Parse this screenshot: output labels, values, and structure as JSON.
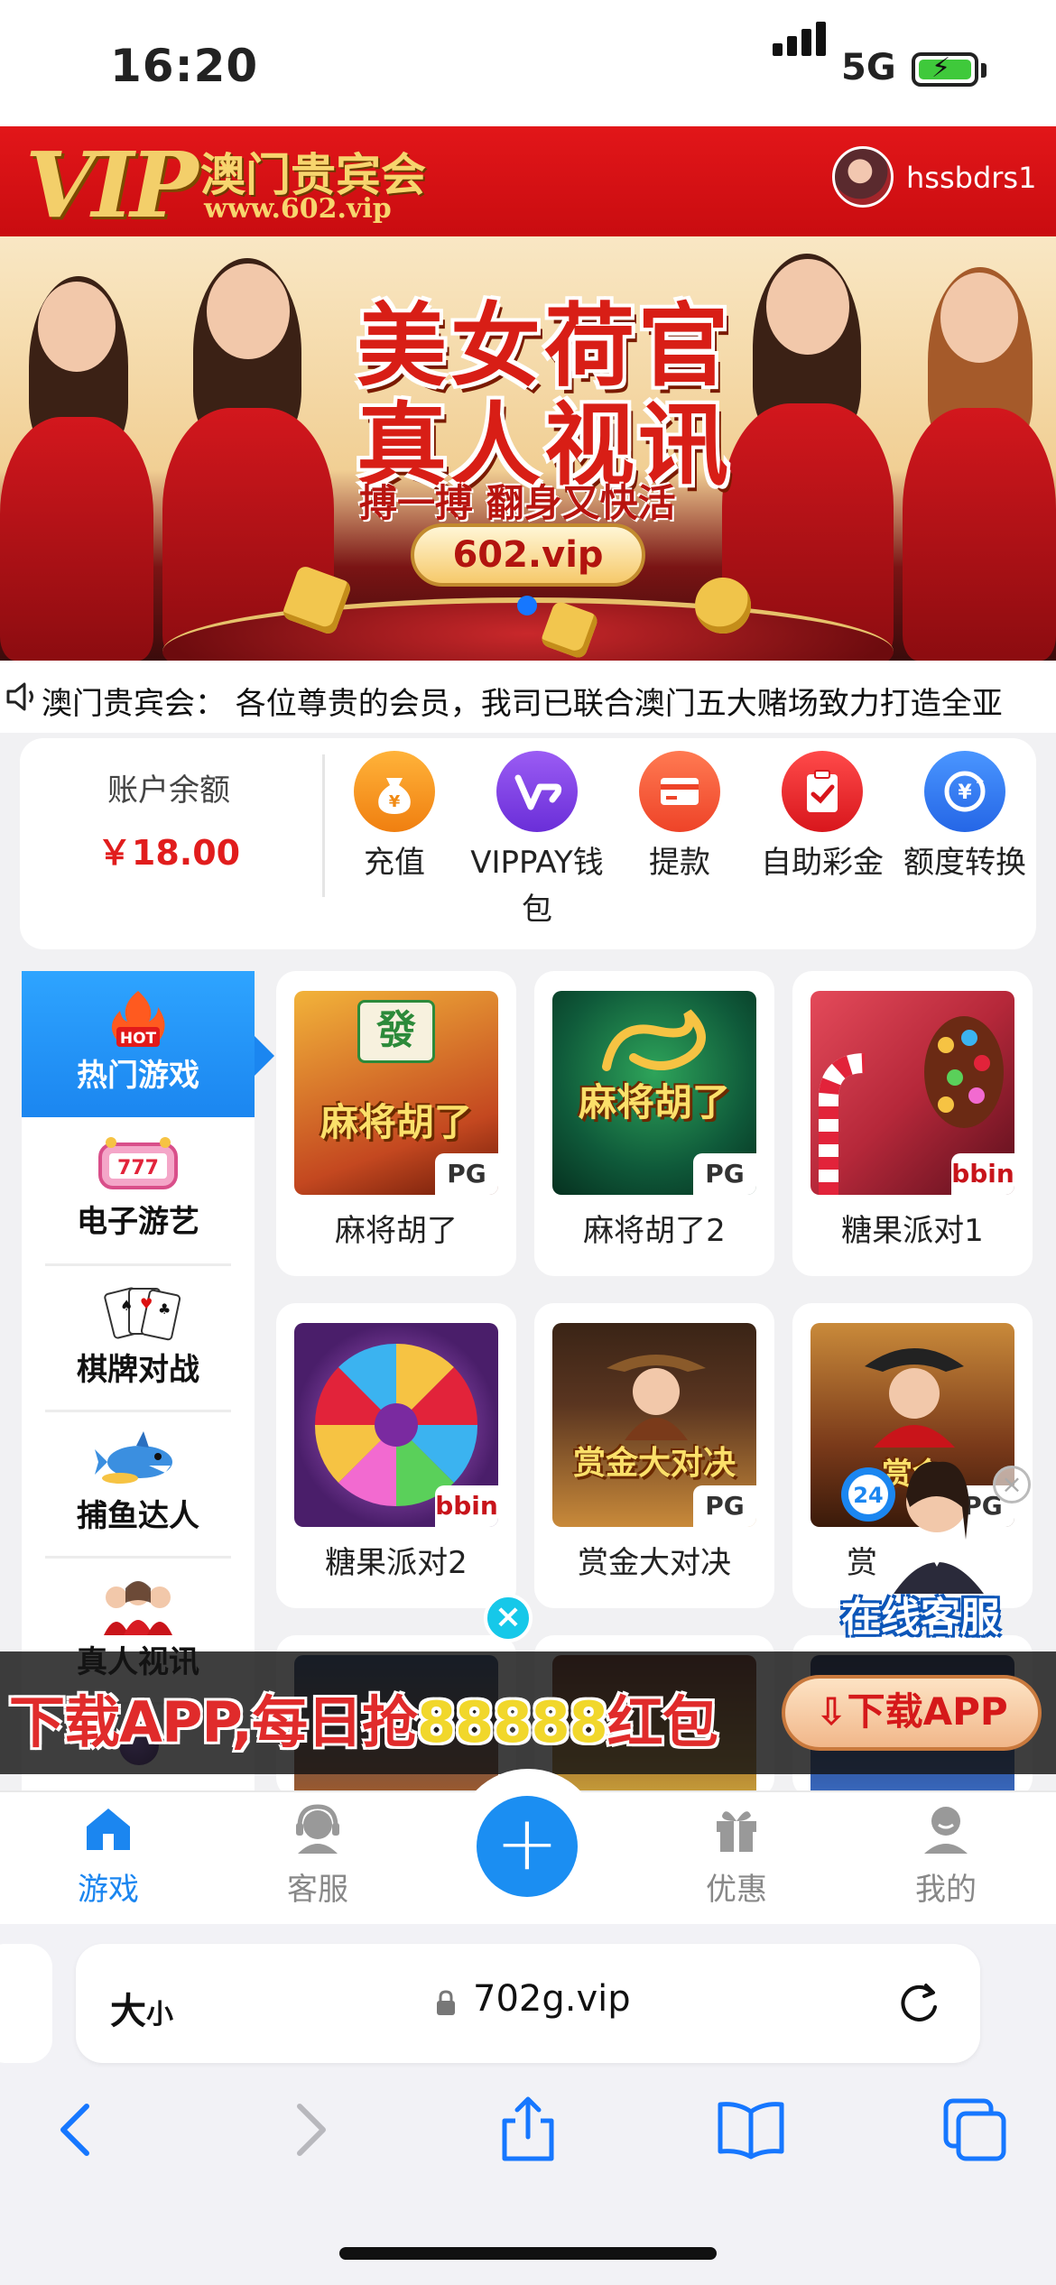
{
  "status": {
    "time": "16:20",
    "network": "5G"
  },
  "header": {
    "logo_vip": "VIP",
    "logo_name": "澳门贵宾会",
    "logo_url": "www.602.vip",
    "username": "hssbdrs1"
  },
  "banner": {
    "title_line1": "美女荷官",
    "title_line2": "真人视讯",
    "slogan": "搏一搏 翻身又快活",
    "site": "602.vip"
  },
  "notice": {
    "text": "澳门贵宾会： 各位尊贵的会员，我司已联合澳门五大赌场致力打造全亚"
  },
  "account": {
    "balance_label": "账户余额",
    "balance_value": "￥18.00",
    "actions": [
      {
        "label": "充值",
        "icon": "money-bag-icon",
        "color": "#f79a1e"
      },
      {
        "label": "VIPPAY钱包",
        "icon": "vippay-icon",
        "color": "#7b3fe0"
      },
      {
        "label": "提款",
        "icon": "card-icon",
        "color": "#f0563a"
      },
      {
        "label": "自助彩金",
        "icon": "clipboard-check-icon",
        "color": "#e6262c"
      },
      {
        "label": "额度转换",
        "icon": "exchange-icon",
        "color": "#2f7bf0"
      }
    ]
  },
  "sidebar": {
    "items": [
      {
        "label": "热门游戏",
        "icon": "hot-fire-icon",
        "badge": "HOT"
      },
      {
        "label": "电子游艺",
        "icon": "slot-777-icon"
      },
      {
        "label": "棋牌对战",
        "icon": "playing-cards-icon"
      },
      {
        "label": "捕鱼达人",
        "icon": "shark-icon"
      },
      {
        "label": "真人视讯",
        "icon": "live-dealers-icon"
      }
    ]
  },
  "games": [
    {
      "name": "麻将胡了",
      "provider": "PG",
      "art_text": "麻将胡了",
      "bg": "#c44820"
    },
    {
      "name": "麻将胡了2",
      "provider": "PG",
      "art_text": "麻将胡了",
      "bg": "#0f5a3a"
    },
    {
      "name": "糖果派对1",
      "provider": "bbin",
      "bg": "#b6283a"
    },
    {
      "name": "糖果派对2",
      "provider": "bbin",
      "bg": "#4a1e6a"
    },
    {
      "name": "赏金大对决",
      "provider": "PG",
      "art_text": "赏金大对决",
      "bg": "#5a3520"
    },
    {
      "name": "赏",
      "provider": "PG",
      "art_text": "赏金",
      "bg": "#7a3a1a"
    }
  ],
  "customer_service": {
    "label": "在线客服",
    "close": "×"
  },
  "download": {
    "text_a": "下载APP,每日抢",
    "text_b": "88888",
    "text_c": "红包",
    "button": "下载APP",
    "close": "×"
  },
  "tabbar": {
    "items": [
      {
        "label": "游戏",
        "icon": "home-icon"
      },
      {
        "label": "客服",
        "icon": "headset-icon"
      },
      {
        "label": "",
        "icon": "plus-icon"
      },
      {
        "label": "优惠",
        "icon": "gift-icon"
      },
      {
        "label": "我的",
        "icon": "user-icon"
      }
    ],
    "center": "+"
  },
  "browser": {
    "aa_big": "大",
    "aa_small": "小",
    "url": "702g.vip"
  }
}
